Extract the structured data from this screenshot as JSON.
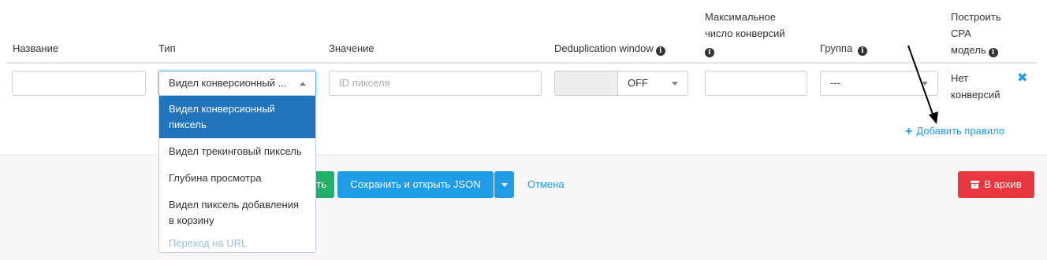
{
  "columns": {
    "name": "Название",
    "type": "Тип",
    "value": "Значение",
    "dedup": "Deduplication window",
    "max_conv_line1": "Максимальное",
    "max_conv_line2": "число конверсий",
    "group": "Группа",
    "cpa_line1": "Построить",
    "cpa_line2": "CPA",
    "cpa_line3": "модель"
  },
  "row": {
    "name_value": "",
    "type_selected": "Видел конверсионный ...",
    "value_placeholder": "ID пикселя",
    "dedup_value": "OFF",
    "max_conv_value": "",
    "group_selected": "---",
    "cpa_line1": "Нет",
    "cpa_line2": "конверсий"
  },
  "type_dropdown": {
    "options": [
      "Видел конверсионный пиксель",
      "Видел трекинговый пиксель",
      "Глубина просмотра",
      "Видел пиксель добавления в корзину",
      "Переход на URL"
    ],
    "selected_index": 0
  },
  "add_rule": "Добавить правило",
  "actions": {
    "save_tail": "ть",
    "save_open_json": "Сохранить и открыть JSON",
    "cancel": "Отмена",
    "archive": "В архив"
  },
  "icons": {
    "info": "info-icon",
    "remove": "close-icon",
    "add": "plus-icon",
    "archive": "archive-icon",
    "annotation": "arrow-annotation"
  },
  "colors": {
    "primary": "#1f9ce6",
    "success": "#1fb266",
    "danger": "#e8373e",
    "selected": "#1f74bd"
  }
}
